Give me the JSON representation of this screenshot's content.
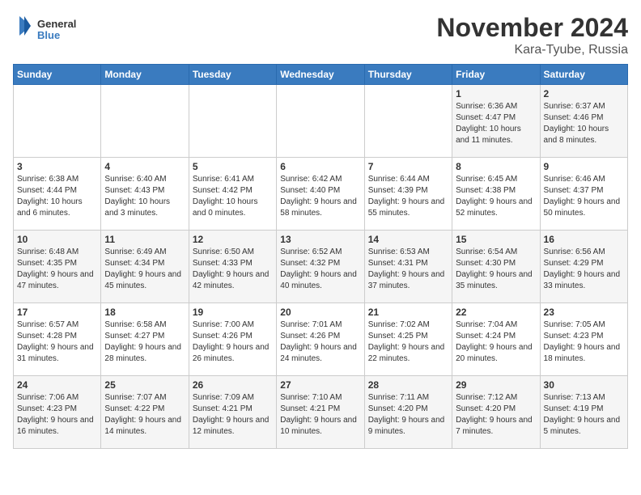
{
  "header": {
    "logo_general": "General",
    "logo_blue": "Blue",
    "month": "November 2024",
    "location": "Kara-Tyube, Russia"
  },
  "days_of_week": [
    "Sunday",
    "Monday",
    "Tuesday",
    "Wednesday",
    "Thursday",
    "Friday",
    "Saturday"
  ],
  "weeks": [
    [
      {
        "day": "",
        "info": ""
      },
      {
        "day": "",
        "info": ""
      },
      {
        "day": "",
        "info": ""
      },
      {
        "day": "",
        "info": ""
      },
      {
        "day": "",
        "info": ""
      },
      {
        "day": "1",
        "info": "Sunrise: 6:36 AM\nSunset: 4:47 PM\nDaylight: 10 hours and 11 minutes."
      },
      {
        "day": "2",
        "info": "Sunrise: 6:37 AM\nSunset: 4:46 PM\nDaylight: 10 hours and 8 minutes."
      }
    ],
    [
      {
        "day": "3",
        "info": "Sunrise: 6:38 AM\nSunset: 4:44 PM\nDaylight: 10 hours and 6 minutes."
      },
      {
        "day": "4",
        "info": "Sunrise: 6:40 AM\nSunset: 4:43 PM\nDaylight: 10 hours and 3 minutes."
      },
      {
        "day": "5",
        "info": "Sunrise: 6:41 AM\nSunset: 4:42 PM\nDaylight: 10 hours and 0 minutes."
      },
      {
        "day": "6",
        "info": "Sunrise: 6:42 AM\nSunset: 4:40 PM\nDaylight: 9 hours and 58 minutes."
      },
      {
        "day": "7",
        "info": "Sunrise: 6:44 AM\nSunset: 4:39 PM\nDaylight: 9 hours and 55 minutes."
      },
      {
        "day": "8",
        "info": "Sunrise: 6:45 AM\nSunset: 4:38 PM\nDaylight: 9 hours and 52 minutes."
      },
      {
        "day": "9",
        "info": "Sunrise: 6:46 AM\nSunset: 4:37 PM\nDaylight: 9 hours and 50 minutes."
      }
    ],
    [
      {
        "day": "10",
        "info": "Sunrise: 6:48 AM\nSunset: 4:35 PM\nDaylight: 9 hours and 47 minutes."
      },
      {
        "day": "11",
        "info": "Sunrise: 6:49 AM\nSunset: 4:34 PM\nDaylight: 9 hours and 45 minutes."
      },
      {
        "day": "12",
        "info": "Sunrise: 6:50 AM\nSunset: 4:33 PM\nDaylight: 9 hours and 42 minutes."
      },
      {
        "day": "13",
        "info": "Sunrise: 6:52 AM\nSunset: 4:32 PM\nDaylight: 9 hours and 40 minutes."
      },
      {
        "day": "14",
        "info": "Sunrise: 6:53 AM\nSunset: 4:31 PM\nDaylight: 9 hours and 37 minutes."
      },
      {
        "day": "15",
        "info": "Sunrise: 6:54 AM\nSunset: 4:30 PM\nDaylight: 9 hours and 35 minutes."
      },
      {
        "day": "16",
        "info": "Sunrise: 6:56 AM\nSunset: 4:29 PM\nDaylight: 9 hours and 33 minutes."
      }
    ],
    [
      {
        "day": "17",
        "info": "Sunrise: 6:57 AM\nSunset: 4:28 PM\nDaylight: 9 hours and 31 minutes."
      },
      {
        "day": "18",
        "info": "Sunrise: 6:58 AM\nSunset: 4:27 PM\nDaylight: 9 hours and 28 minutes."
      },
      {
        "day": "19",
        "info": "Sunrise: 7:00 AM\nSunset: 4:26 PM\nDaylight: 9 hours and 26 minutes."
      },
      {
        "day": "20",
        "info": "Sunrise: 7:01 AM\nSunset: 4:26 PM\nDaylight: 9 hours and 24 minutes."
      },
      {
        "day": "21",
        "info": "Sunrise: 7:02 AM\nSunset: 4:25 PM\nDaylight: 9 hours and 22 minutes."
      },
      {
        "day": "22",
        "info": "Sunrise: 7:04 AM\nSunset: 4:24 PM\nDaylight: 9 hours and 20 minutes."
      },
      {
        "day": "23",
        "info": "Sunrise: 7:05 AM\nSunset: 4:23 PM\nDaylight: 9 hours and 18 minutes."
      }
    ],
    [
      {
        "day": "24",
        "info": "Sunrise: 7:06 AM\nSunset: 4:23 PM\nDaylight: 9 hours and 16 minutes."
      },
      {
        "day": "25",
        "info": "Sunrise: 7:07 AM\nSunset: 4:22 PM\nDaylight: 9 hours and 14 minutes."
      },
      {
        "day": "26",
        "info": "Sunrise: 7:09 AM\nSunset: 4:21 PM\nDaylight: 9 hours and 12 minutes."
      },
      {
        "day": "27",
        "info": "Sunrise: 7:10 AM\nSunset: 4:21 PM\nDaylight: 9 hours and 10 minutes."
      },
      {
        "day": "28",
        "info": "Sunrise: 7:11 AM\nSunset: 4:20 PM\nDaylight: 9 hours and 9 minutes."
      },
      {
        "day": "29",
        "info": "Sunrise: 7:12 AM\nSunset: 4:20 PM\nDaylight: 9 hours and 7 minutes."
      },
      {
        "day": "30",
        "info": "Sunrise: 7:13 AM\nSunset: 4:19 PM\nDaylight: 9 hours and 5 minutes."
      }
    ]
  ]
}
